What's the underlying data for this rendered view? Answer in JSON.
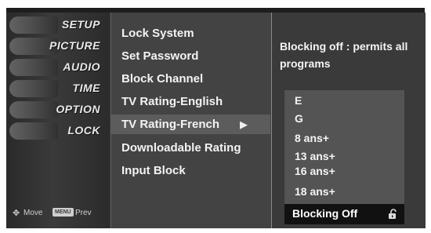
{
  "sidebar": {
    "items": [
      {
        "label": "SETUP",
        "icon": "satellite-dish-icon"
      },
      {
        "label": "PICTURE",
        "icon": "film-strip-icon"
      },
      {
        "label": "AUDIO",
        "icon": "speaker-icon"
      },
      {
        "label": "TIME",
        "icon": "clock-icon"
      },
      {
        "label": "OPTION",
        "icon": "option-gear-icon"
      },
      {
        "label": "LOCK",
        "icon": "lock-icon"
      }
    ],
    "legend": {
      "move_label": "Move",
      "menu_key": "MENU",
      "prev_label": "Prev"
    }
  },
  "menu": {
    "items": [
      {
        "label": "Lock System"
      },
      {
        "label": "Set Password"
      },
      {
        "label": "Block Channel"
      },
      {
        "label": "TV Rating-English"
      },
      {
        "label": "TV Rating-French"
      },
      {
        "label": "Downloadable Rating"
      },
      {
        "label": "Input Block"
      }
    ],
    "selected_index": 4
  },
  "panel": {
    "description": "Blocking off : permits all programs",
    "options": [
      "E",
      "G",
      "8 ans+",
      "13 ans+",
      "16 ans+",
      "18 ans+"
    ],
    "selected_value": "Blocking Off",
    "selected_icon": "unlock-icon"
  },
  "colors": {
    "background": "#3b3b3b",
    "highlight": "#5c5c5c",
    "selected": "#111111",
    "text": "#f3f3f3"
  }
}
